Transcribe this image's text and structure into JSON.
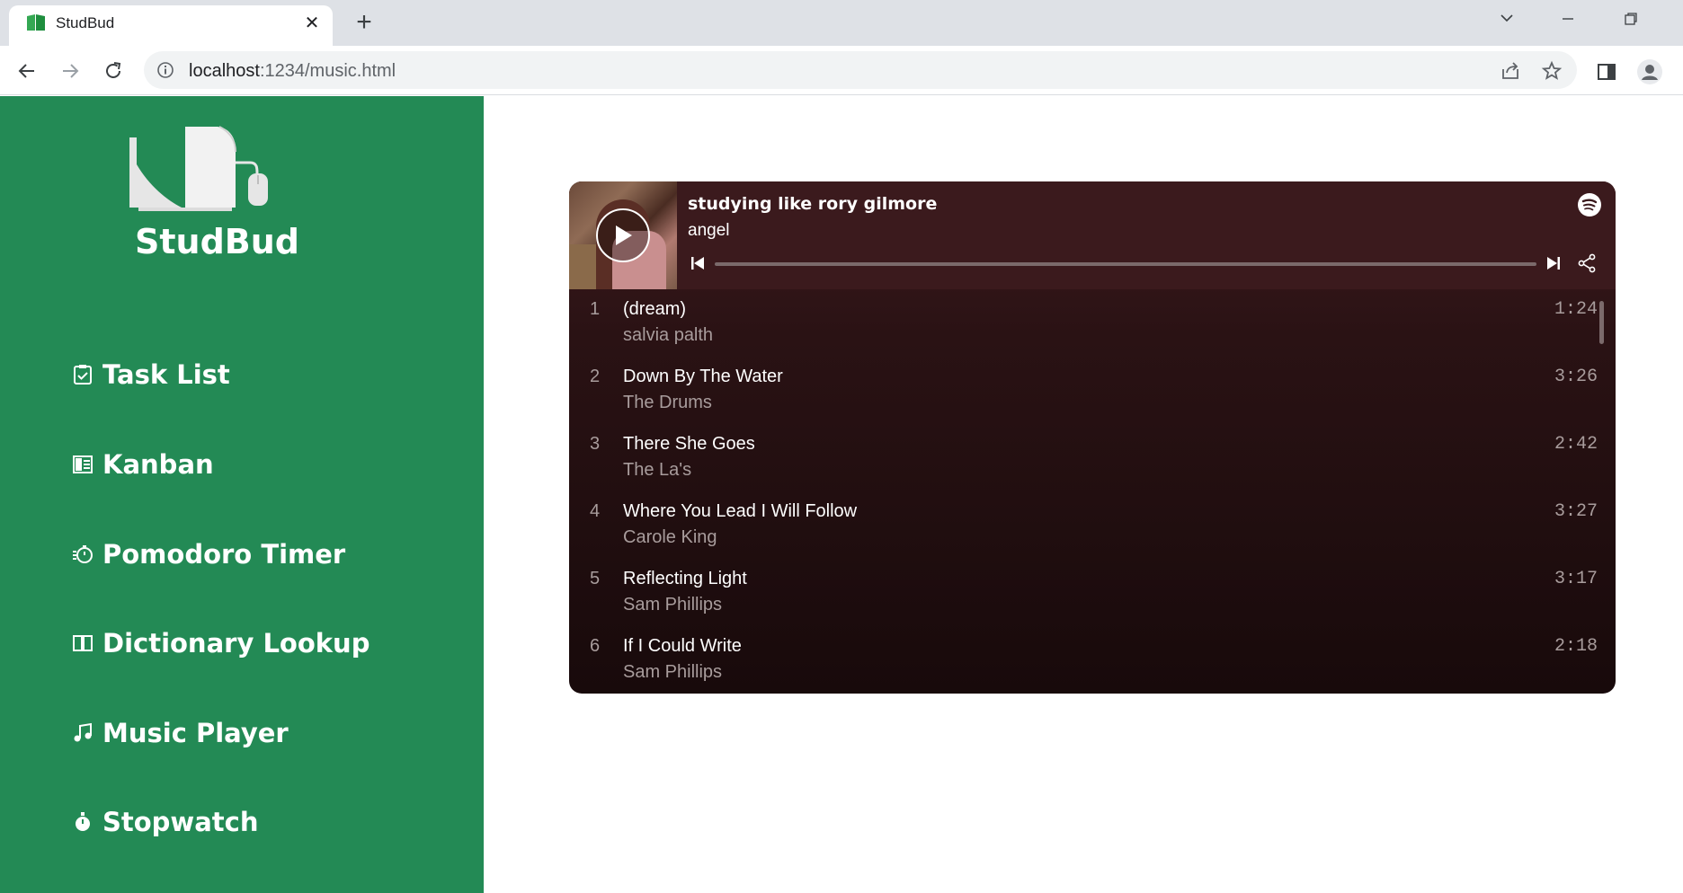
{
  "browser": {
    "tab_title": "StudBud",
    "url_host": "localhost",
    "url_path": ":1234/music.html"
  },
  "app": {
    "logo_text": "StudBud",
    "brand_color": "#238a55",
    "nav": [
      {
        "label": "Task List",
        "icon": "clipboard-check-icon"
      },
      {
        "label": "Kanban",
        "icon": "kanban-board-icon"
      },
      {
        "label": "Pomodoro Timer",
        "icon": "timer-icon"
      },
      {
        "label": "Dictionary Lookup",
        "icon": "open-book-icon"
      },
      {
        "label": "Music Player",
        "icon": "music-note-icon"
      },
      {
        "label": "Stopwatch",
        "icon": "stopwatch-icon"
      }
    ]
  },
  "player": {
    "playlist_title": "studying like rory gilmore",
    "owner": "angel",
    "tracks": [
      {
        "num": "1",
        "title": "(dream)",
        "artist": "salvia palth",
        "duration": "1:24"
      },
      {
        "num": "2",
        "title": "Down By The Water",
        "artist": "The Drums",
        "duration": "3:26"
      },
      {
        "num": "3",
        "title": "There She Goes",
        "artist": "The La's",
        "duration": "2:42"
      },
      {
        "num": "4",
        "title": "Where You Lead I Will Follow",
        "artist": "Carole King",
        "duration": "3:27"
      },
      {
        "num": "5",
        "title": "Reflecting Light",
        "artist": "Sam Phillips",
        "duration": "3:17"
      },
      {
        "num": "6",
        "title": "If I Could Write",
        "artist": "Sam Phillips",
        "duration": "2:18"
      }
    ]
  }
}
